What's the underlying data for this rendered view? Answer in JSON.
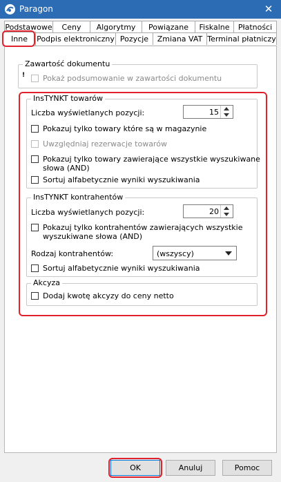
{
  "window": {
    "title": "Paragon",
    "app_icon": "paragon-logo-icon",
    "close_icon": "close-icon"
  },
  "tabs_row1": [
    {
      "label": "Podstawowe"
    },
    {
      "label": "Ceny"
    },
    {
      "label": "Algorytmy"
    },
    {
      "label": "Powiązane"
    },
    {
      "label": "Fiskalne"
    },
    {
      "label": "Płatności"
    }
  ],
  "tabs_row2": [
    {
      "label": "Inne",
      "active": true
    },
    {
      "label": "Podpis elektroniczny"
    },
    {
      "label": "Pozycje"
    },
    {
      "label": "Zmiana VAT"
    },
    {
      "label": "Terminal płatniczy"
    }
  ],
  "zawartosc": {
    "title": "Zawartość dokumentu",
    "show_summary_label": "Pokaż podsumowanie w zawartości dokumentu",
    "show_summary_checked": false,
    "show_summary_disabled": true
  },
  "instynkt_towarow": {
    "title": "InsTYNKT towarów",
    "count_label": "Liczba wyświetlanych pozycji:",
    "count_value": "15",
    "only_in_stock_label": "Pokazuj tylko towary które są w magazynie",
    "reservations_label": "Uwzględniaj rezerwacje towarów",
    "all_words_label_line1": "Pokazuj tylko towary zawierające wszystkie wyszukiwane",
    "all_words_label_line2": "słowa (AND)",
    "sort_label": "Sortuj alfabetycznie wyniki wyszukiwania"
  },
  "instynkt_kontrahentow": {
    "title": "InsTYNKT kontrahentów",
    "count_label": "Liczba wyświetlanych pozycji:",
    "count_value": "20",
    "all_words_label_line1": "Pokazuj tylko kontrahentów zawierających wszystkie",
    "all_words_label_line2": "wyszukiwane słowa (AND)",
    "type_label": "Rodzaj kontrahentów:",
    "type_value": "(wszyscy)",
    "sort_label": "Sortuj alfabetycznie wyniki wyszukiwania"
  },
  "akcyza": {
    "title": "Akcyza",
    "add_excise_label": "Dodaj kwotę akcyzy do ceny netto"
  },
  "buttons": {
    "ok": "OK",
    "cancel": "Anuluj",
    "help": "Pomoc"
  },
  "colors": {
    "titlebar": "#2b6cb5",
    "highlight": "#e0202a"
  }
}
